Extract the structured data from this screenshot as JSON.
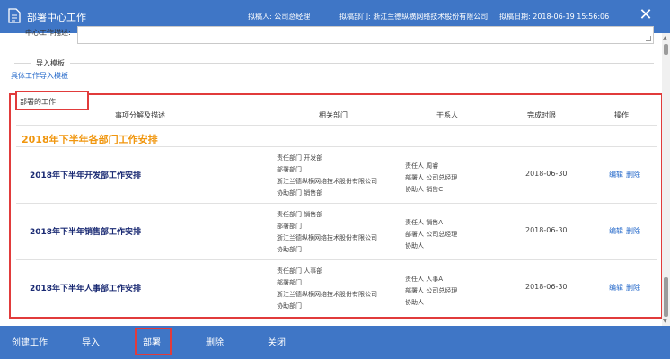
{
  "window": {
    "title": "部署中心工作",
    "drafter": "拟稿人: 公司总经理",
    "department": "拟稿部门: 浙江兰德纵横网络技术股份有限公司",
    "date": "拟稿日期: 2018-06-19 15:56:06",
    "close_label": "✕"
  },
  "form": {
    "description_label": "中心工作描述:",
    "import_legend": "导入模板",
    "import_link": "具体工作导入模板",
    "dept_legend": "部署的工作"
  },
  "table": {
    "headers": [
      "事项分解及描述",
      "相关部门",
      "干系人",
      "完成时限",
      "操作"
    ],
    "group_title": "2018年下半年各部门工作安排",
    "rows": [
      {
        "name": "2018年下半年开发部工作安排",
        "dept_lines": [
          "责任部门   开发部",
          "部署部门",
          "浙江兰德纵横网络技术股份有限公司",
          "协助部门   销售部"
        ],
        "person_lines": [
          "责任人   周睿",
          "部署人   公司总经理",
          "协助人   销售C"
        ],
        "deadline": "2018-06-30",
        "edit": "编辑",
        "delete": "删除"
      },
      {
        "name": "2018年下半年销售部工作安排",
        "dept_lines": [
          "责任部门   销售部",
          "部署部门",
          "浙江兰德纵横网络技术股份有限公司",
          "协助部门"
        ],
        "person_lines": [
          "责任人   销售A",
          "部署人   公司总经理",
          "协助人"
        ],
        "deadline": "2018-06-30",
        "edit": "编辑",
        "delete": "删除"
      },
      {
        "name": "2018年下半年人事部工作安排",
        "dept_lines": [
          "责任部门   人事部",
          "部署部门",
          "浙江兰德纵横网络技术股份有限公司",
          "协助部门"
        ],
        "person_lines": [
          "责任人   人事A",
          "部署人   公司总经理",
          "协助人"
        ],
        "deadline": "2018-06-30",
        "edit": "编辑",
        "delete": "删除"
      }
    ]
  },
  "footer": {
    "create": "创建工作",
    "import": "导入",
    "deploy": "部署",
    "delete": "删除",
    "close": "关闭"
  },
  "colors": {
    "header_bg": "#3f76c6",
    "highlight_red": "#e13b3b",
    "group_orange": "#f0960e",
    "row_title": "#1a2a73",
    "link_blue": "#1e64c8"
  }
}
